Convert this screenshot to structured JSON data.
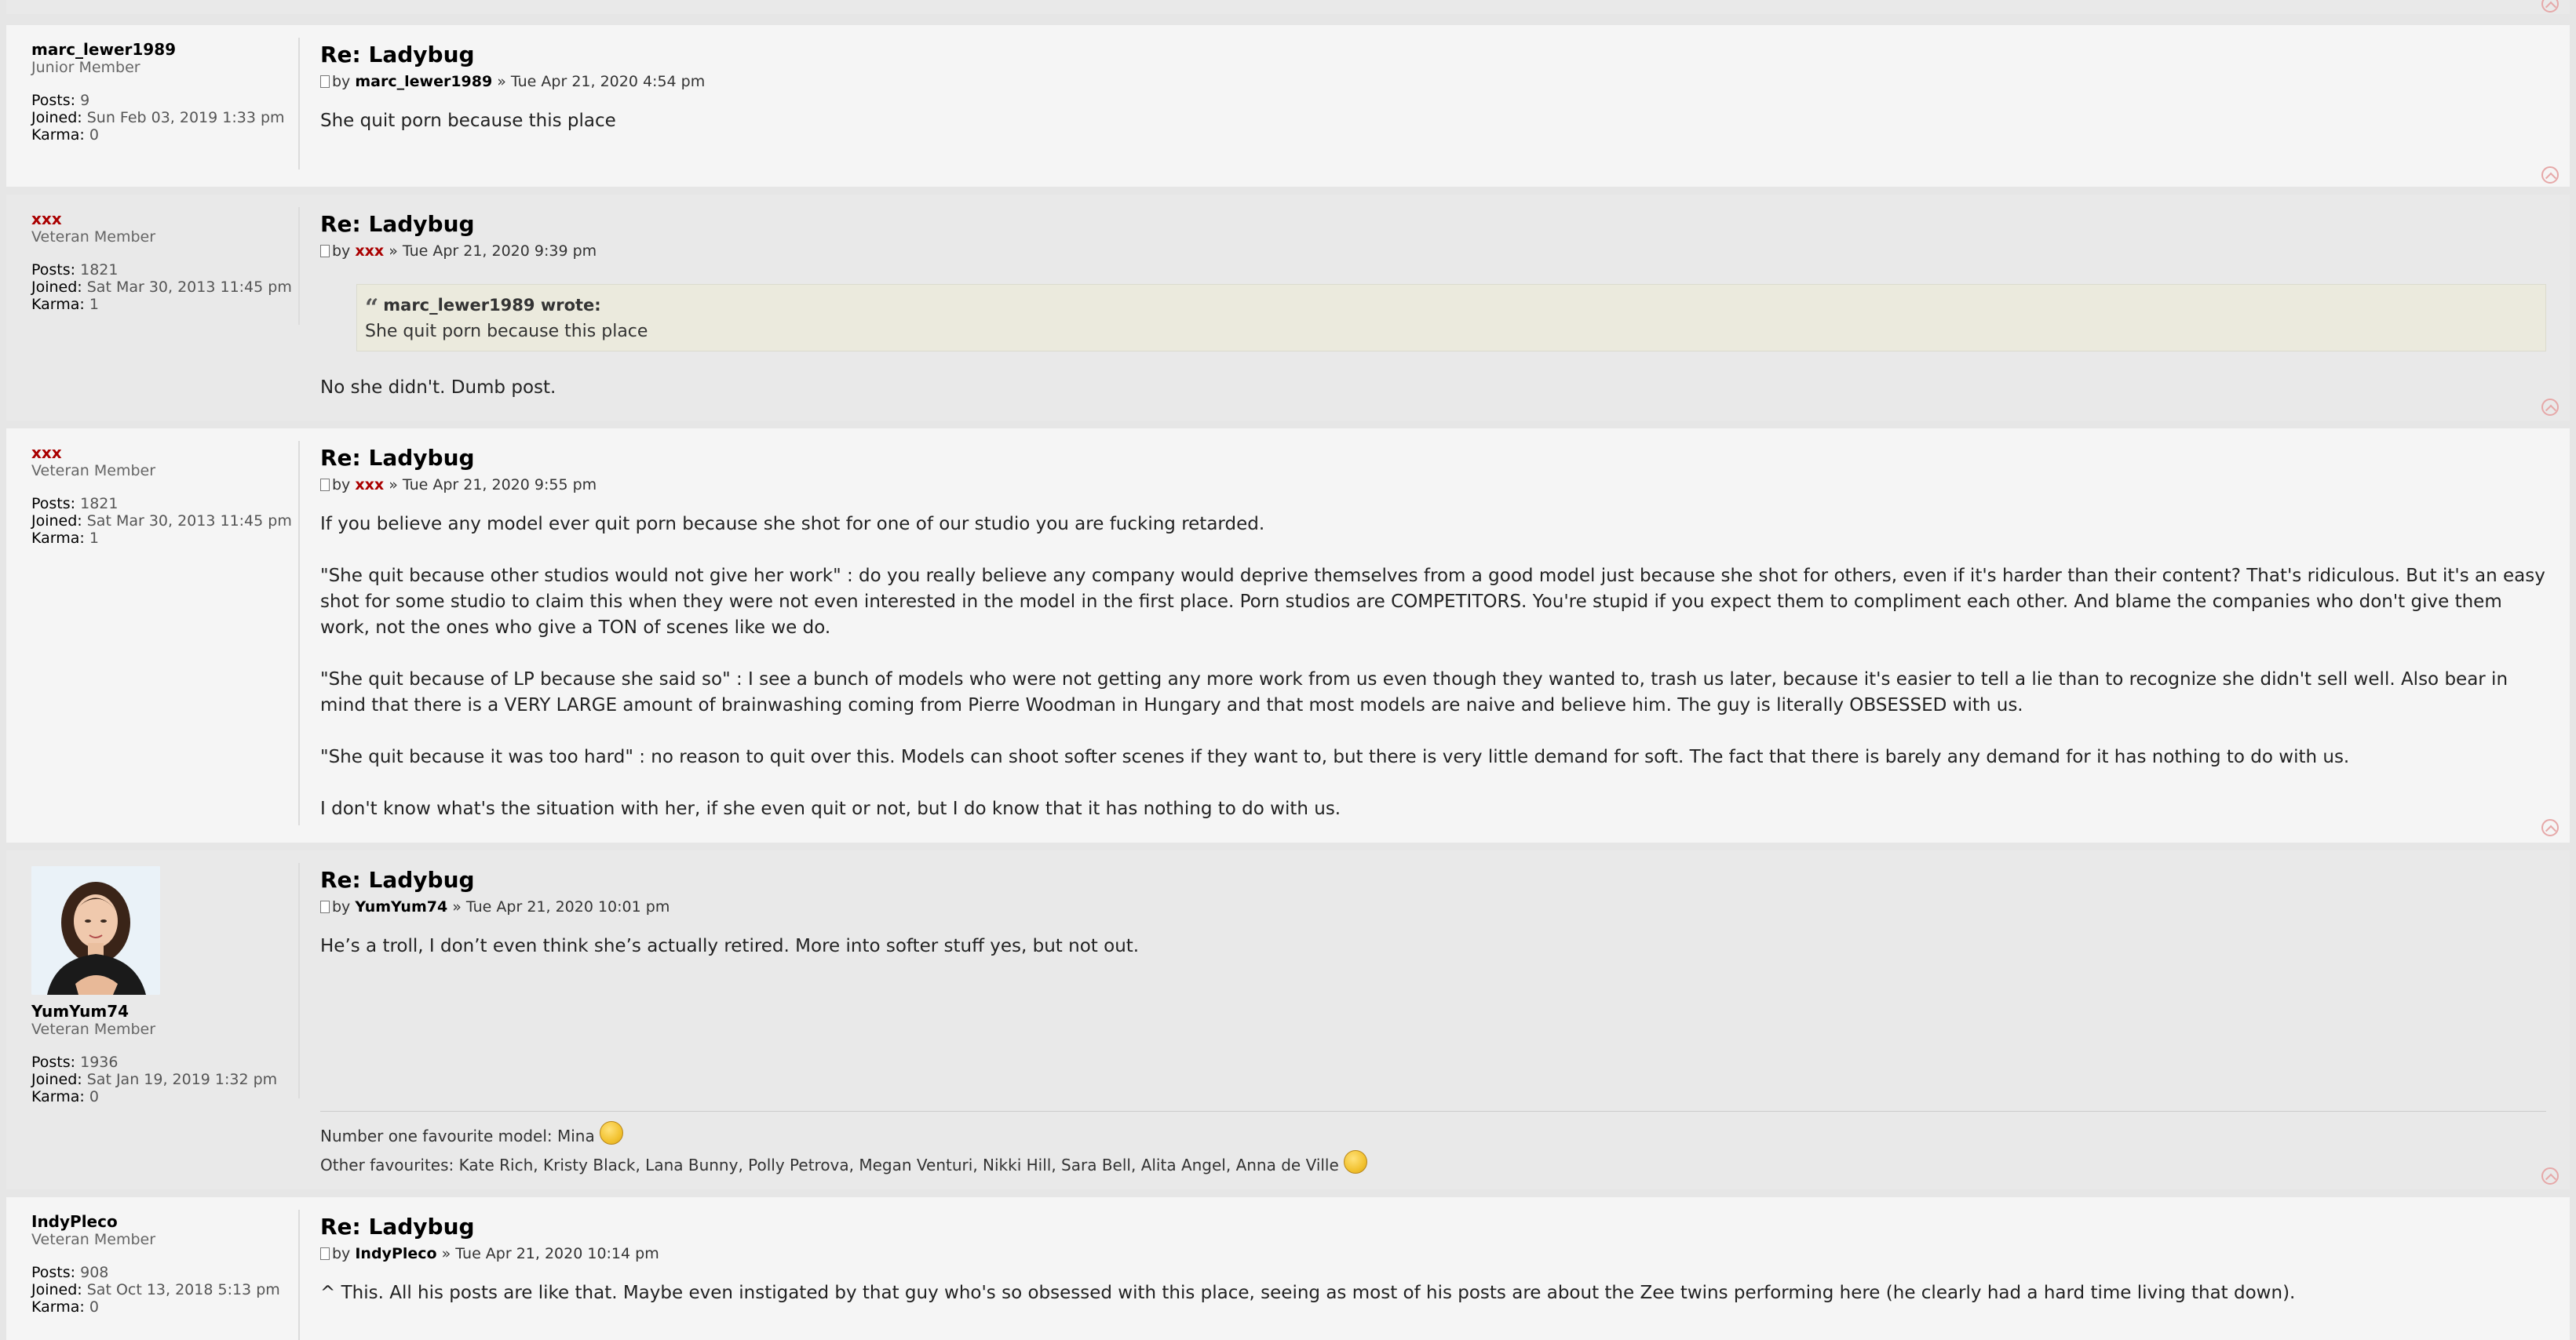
{
  "posts": [
    {
      "username": "marc_lewer1989",
      "rank": "Junior Member",
      "posts_label": "Posts:",
      "posts": "9",
      "joined_label": "Joined:",
      "joined": "Sun Feb 03, 2019 1:33 pm",
      "karma_label": "Karma:",
      "karma": "0",
      "title": "Re: Ladybug",
      "by": "by",
      "author": "marc_lewer1989",
      "date": "» Tue Apr 21, 2020 4:54 pm",
      "content": [
        "She quit porn because this place"
      ]
    },
    {
      "username": "xxx",
      "rank": "Veteran Member",
      "posts_label": "Posts:",
      "posts": "1821",
      "joined_label": "Joined:",
      "joined": "Sat Mar 30, 2013 11:45 pm",
      "karma_label": "Karma:",
      "karma": "1",
      "title": "Re: Ladybug",
      "by": "by",
      "author": "xxx",
      "date": "» Tue Apr 21, 2020 9:39 pm",
      "quote_author": "marc_lewer1989 wrote:",
      "quote_text": "She quit porn because this place",
      "content": [
        "No she didn't. Dumb post."
      ]
    },
    {
      "username": "xxx",
      "rank": "Veteran Member",
      "posts_label": "Posts:",
      "posts": "1821",
      "joined_label": "Joined:",
      "joined": "Sat Mar 30, 2013 11:45 pm",
      "karma_label": "Karma:",
      "karma": "1",
      "title": "Re: Ladybug",
      "by": "by",
      "author": "xxx",
      "date": "» Tue Apr 21, 2020 9:55 pm",
      "content": [
        "If you believe any model ever quit porn because she shot for one of our studio you are fucking retarded.",
        "\"She quit because other studios would not give her work\" : do you really believe any company would deprive themselves from a good model just because she shot for others, even if it's harder than their content? That's ridiculous. But it's an easy shot for some studio to claim this when they were not even interested in the model in the first place. Porn studios are COMPETITORS. You're stupid if you expect them to compliment each other. And blame the companies who don't give them work, not the ones who give a TON of scenes like we do.",
        "\"She quit because of LP because she said so\" : I see a bunch of models who were not getting any more work from us even though they wanted to, trash us later, because it's easier to tell a lie than to recognize she didn't sell well. Also bear in mind that there is a VERY LARGE amount of brainwashing coming from Pierre Woodman in Hungary and that most models are naive and believe him. The guy is literally OBSESSED with us.",
        "\"She quit because it was too hard\" : no reason to quit over this. Models can shoot softer scenes if they want to, but there is very little demand for soft. The fact that there is barely any demand for it has nothing to do with us.",
        "I don't know what's the situation with her, if she even quit or not, but I do know that it has nothing to do with us."
      ]
    },
    {
      "username": "YumYum74",
      "rank": "Veteran Member",
      "posts_label": "Posts:",
      "posts": "1936",
      "joined_label": "Joined:",
      "joined": "Sat Jan 19, 2019 1:32 pm",
      "karma_label": "Karma:",
      "karma": "0",
      "title": "Re: Ladybug",
      "by": "by",
      "author": "YumYum74",
      "date": "» Tue Apr 21, 2020 10:01 pm",
      "content": [
        "He’s a troll, I don’t even think she’s actually retired. More into softer stuff yes, but not out."
      ],
      "signature_line1": "Number one favourite model: Mina",
      "signature_line2": "Other favourites: Kate Rich, Kristy Black, Lana Bunny, Polly Petrova, Megan Venturi, Nikki Hill, Sara Bell, Alita Angel, Anna de Ville"
    },
    {
      "username": "IndyPleco",
      "rank": "Veteran Member",
      "posts_label": "Posts:",
      "posts": "908",
      "joined_label": "Joined:",
      "joined": "Sat Oct 13, 2018 5:13 pm",
      "karma_label": "Karma:",
      "karma": "0",
      "title": "Re: Ladybug",
      "by": "by",
      "author": "IndyPleco",
      "date": "» Tue Apr 21, 2020 10:14 pm",
      "content": [
        "^ This. All his posts are like that. Maybe even instigated by that guy who's so obsessed with this place, seeing as most of his posts are about the Zee twins performing here (he clearly had a hard time living that down)."
      ]
    }
  ]
}
